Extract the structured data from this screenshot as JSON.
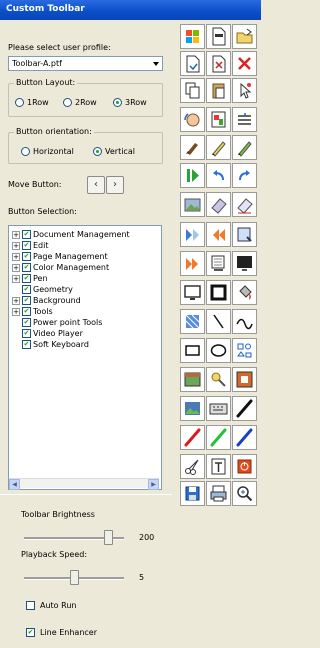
{
  "window": {
    "title": "Custom Toolbar"
  },
  "profile": {
    "label": "Please select user profile:",
    "value": "Toolbar-A.ptf"
  },
  "layout": {
    "label": "Button Layout:",
    "options": [
      "1Row",
      "2Row",
      "3Row"
    ],
    "selected": "3Row"
  },
  "orientation": {
    "label": "Button orientation:",
    "options": [
      "Horizontal",
      "Vertical"
    ],
    "selected": "Vertical"
  },
  "move": {
    "label": "Move Button:",
    "left": "‹",
    "right": "›"
  },
  "selection": {
    "label": "Button Selection:",
    "items": [
      {
        "text": "Document Management",
        "expandable": true,
        "checked": true
      },
      {
        "text": "Edit",
        "expandable": true,
        "checked": true
      },
      {
        "text": "Page Management",
        "expandable": true,
        "checked": true
      },
      {
        "text": "Color Management",
        "expandable": true,
        "checked": true
      },
      {
        "text": "Pen",
        "expandable": true,
        "checked": true
      },
      {
        "text": "Geometry",
        "expandable": false,
        "checked": true
      },
      {
        "text": "Background",
        "expandable": true,
        "checked": true
      },
      {
        "text": "Tools",
        "expandable": true,
        "checked": true
      },
      {
        "text": "Power point Tools",
        "expandable": false,
        "checked": true
      },
      {
        "text": "Video Player",
        "expandable": false,
        "checked": true
      },
      {
        "text": "Soft Keyboard",
        "expandable": false,
        "checked": true
      }
    ]
  },
  "brightness": {
    "label": "Toolbar Brightness",
    "value": "200",
    "level": 0.84
  },
  "playback": {
    "label": "Playback Speed:",
    "value": "5",
    "level": 0.5
  },
  "auto_run": {
    "label": "Auto Run",
    "checked": false
  },
  "line_enhancer": {
    "label": "Line Enhancer",
    "checked": true
  },
  "check_mark": "✔",
  "toolbar_icons": [
    "windows-icon",
    "new-page-icon",
    "open-folder-icon",
    "save-document-icon",
    "delete-page-icon",
    "delete-icon",
    "copy-icon",
    "paste-icon",
    "select-cursor-icon",
    "hand-icon",
    "page-view-icon",
    "insert-line-icon",
    "brush-icon",
    "pen-yellow-icon",
    "pen-green-icon",
    "play-icon",
    "undo-icon",
    "redo-icon",
    "gallery-icon",
    "eraser-icon",
    "eraser-clear-icon",
    "recognize-icon",
    "previous-page-icon",
    "page-list-icon",
    "next-page-icon",
    "slides-icon",
    "screen-icon",
    "monitor-icon",
    "frame-icon",
    "fill-bucket-icon",
    "pattern-icon",
    "line-icon",
    "curve-icon",
    "rectangle-icon",
    "ellipse-icon",
    "shapes-icon",
    "background-icon",
    "spotlight-icon",
    "screen-capture-icon",
    "image-icon",
    "keyboard-icon",
    "pen-black-icon",
    "pen-red-icon",
    "pen-green-2-icon",
    "pen-blue-icon",
    "scissors-icon",
    "text-icon",
    "close-app-icon",
    "disk-save-icon",
    "print-icon",
    "zoom-icon"
  ],
  "colors": {
    "title_bar": "#0a4ec8",
    "check": "#21a121"
  }
}
